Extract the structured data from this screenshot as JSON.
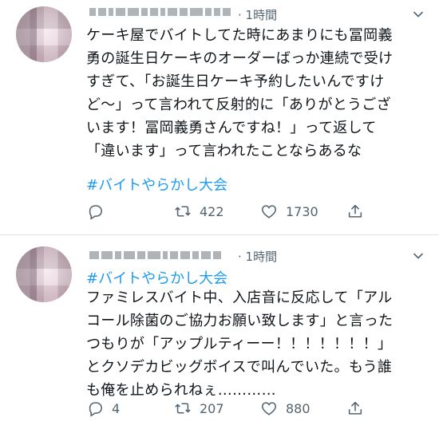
{
  "tweets": [
    {
      "time": "· 1時間",
      "text": "ケーキ屋でバイトしてた時にあまりにも冨岡義\n勇の誕生日ケーキのオーダーばっか連続で受け\nすぎて、「お誕生日ケーキ予約したいんですけ\nど〜」って言われて反射的に「ありがとうござ\nいます！冨岡義勇さんですね！」って返して\n「違います」って言われたことならあるな",
      "hashtag": "#バイトやらかし大会",
      "reply_count": "",
      "retweet_count": "422",
      "like_count": "1730"
    },
    {
      "time": "· 1時間",
      "hashtag": "#バイトやらかし大会",
      "text": "ファミレスバイト中、入店音に反応して「アル\nコール除菌のご協力お願い致します」と言った\nつもりが「アップルティーー！！！！！！！」\nとクソデカビッグボイスで叫んでいた。もう誰\nも俺を止められねぇ…………",
      "reply_count": "4",
      "retweet_count": "207",
      "like_count": "880"
    }
  ],
  "colors": {
    "hashtag": "#1d9bf0",
    "muted": "#536471",
    "text": "#0f1419"
  }
}
